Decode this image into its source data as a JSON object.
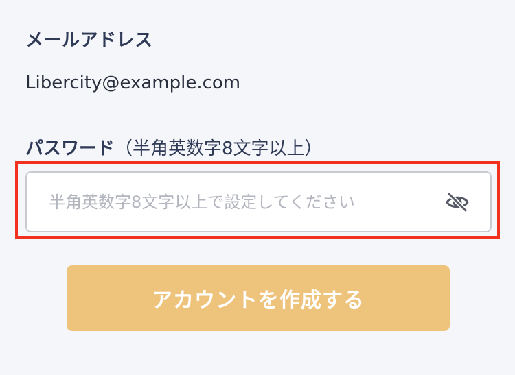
{
  "form": {
    "email_label": "メールアドレス",
    "email_value": "Libercity@example.com",
    "password_label": "パスワード",
    "password_note": "（半角英数字8文字以上）",
    "password_placeholder": "半角英数字8文字以上で設定してください",
    "password_value": "",
    "password_toggle_icon": "eye-slash-icon",
    "submit_label": "アカウントを作成する"
  },
  "colors": {
    "highlight": "#f2311f",
    "button_bg": "#eec47c",
    "button_text": "#ffffff",
    "page_bg": "#f5f6fa",
    "label_text": "#2f3a56",
    "placeholder": "#b3b6bf",
    "icon": "#555a66"
  }
}
